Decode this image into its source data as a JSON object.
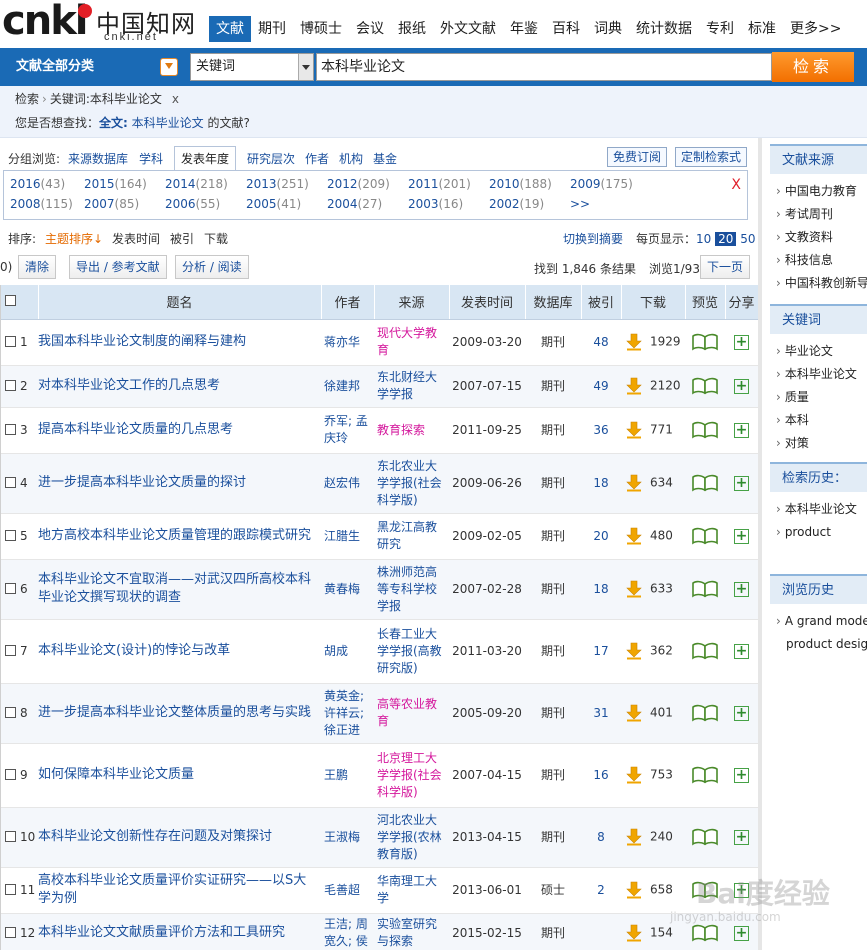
{
  "logo": {
    "zh": "中国知网",
    "sub": "cnki.net",
    "brand": "cnki"
  },
  "nav": [
    "文献",
    "期刊",
    "博硕士",
    "会议",
    "报纸",
    "外文文献",
    "年鉴",
    "百科",
    "词典",
    "统计数据",
    "专利",
    "标准",
    "更多>>"
  ],
  "search": {
    "category": "文献全部分类",
    "field": "关键词",
    "query": "本科毕业论文",
    "button": "检索"
  },
  "breadcrumb": {
    "home": "检索",
    "current": "关键词:本科毕业论文",
    "close": "x"
  },
  "suggest": {
    "prefix": "您是否想查找：",
    "label": "全文:",
    "term": "本科毕业论文",
    "suffix": "的文献?"
  },
  "group": {
    "label": "分组浏览:",
    "items": [
      "来源数据库",
      "学科",
      "发表年度",
      "研究层次",
      "作者",
      "机构",
      "基金"
    ],
    "subscribe": "免费订阅",
    "custom": "定制检索式"
  },
  "years": {
    "row1": [
      {
        "y": "2016",
        "c": "(43)"
      },
      {
        "y": "2015",
        "c": "(164)"
      },
      {
        "y": "2014",
        "c": "(218)"
      },
      {
        "y": "2013",
        "c": "(251)"
      },
      {
        "y": "2012",
        "c": "(209)"
      },
      {
        "y": "2011",
        "c": "(201)"
      },
      {
        "y": "2010",
        "c": "(188)"
      },
      {
        "y": "2009",
        "c": "(175)"
      }
    ],
    "row2": [
      {
        "y": "2008",
        "c": "(115)"
      },
      {
        "y": "2007",
        "c": "(85)"
      },
      {
        "y": "2006",
        "c": "(55)"
      },
      {
        "y": "2005",
        "c": "(41)"
      },
      {
        "y": "2004",
        "c": "(27)"
      },
      {
        "y": "2003",
        "c": "(16)"
      },
      {
        "y": "2002",
        "c": "(19)"
      },
      {
        "y": ">>",
        "c": ""
      }
    ],
    "close": "X"
  },
  "sort": {
    "label": "排序:",
    "items": [
      "主题排序↓",
      "发表时间",
      "被引",
      "下载"
    ],
    "switch": "切换到摘要",
    "per_page_label": "每页显示：",
    "per_page": [
      "10",
      "20",
      "50"
    ]
  },
  "toolbar": {
    "count": "0)",
    "clear": "清除",
    "export": "导出 / 参考文献",
    "analyze": "分析 / 阅读",
    "found": "找到 1,846 条结果",
    "browse": "浏览1/93",
    "next": "下一页"
  },
  "table": {
    "headers": [
      "题名",
      "作者",
      "来源",
      "发表时间",
      "数据库",
      "被引",
      "下载",
      "预览",
      "分享"
    ],
    "rows": [
      {
        "n": "1",
        "title": "我国本科毕业论文制度的阐释与建构",
        "author": "蒋亦华",
        "source": "现代大学教育",
        "mag": true,
        "date": "2009-03-20",
        "db": "期刊",
        "cite": "48",
        "dl": "1929"
      },
      {
        "n": "2",
        "title": "对本科毕业论文工作的几点思考",
        "author": "徐建邦",
        "source": "东北财经大学学报",
        "mag": false,
        "date": "2007-07-15",
        "db": "期刊",
        "cite": "49",
        "dl": "2120"
      },
      {
        "n": "3",
        "title": "提高本科毕业论文质量的几点思考",
        "author": "乔军; 孟庆玲",
        "source": "教育探索",
        "mag": true,
        "date": "2011-09-25",
        "db": "期刊",
        "cite": "36",
        "dl": "771"
      },
      {
        "n": "4",
        "title": "进一步提高本科毕业论文质量的探讨",
        "author": "赵宏伟",
        "source": "东北农业大学学报(社会科学版)",
        "mag": false,
        "date": "2009-06-26",
        "db": "期刊",
        "cite": "18",
        "dl": "634"
      },
      {
        "n": "5",
        "title": "地方高校本科毕业论文质量管理的跟踪模式研究",
        "author": "江腊生",
        "source": "黑龙江高教研究",
        "mag": false,
        "date": "2009-02-05",
        "db": "期刊",
        "cite": "20",
        "dl": "480"
      },
      {
        "n": "6",
        "title": "本科毕业论文不宜取消——对武汉四所高校本科毕业论文撰写现状的调查",
        "author": "黄春梅",
        "source": "株洲师范高等专科学校学报",
        "mag": false,
        "date": "2007-02-28",
        "db": "期刊",
        "cite": "18",
        "dl": "633"
      },
      {
        "n": "7",
        "title": "本科毕业论文(设计)的悖论与改革",
        "author": "胡成",
        "source": "长春工业大学学报(高教研究版)",
        "mag": false,
        "date": "2011-03-20",
        "db": "期刊",
        "cite": "17",
        "dl": "362"
      },
      {
        "n": "8",
        "title": "进一步提高本科毕业论文整体质量的思考与实践",
        "author": "黄英金; 许祥云; 徐正进",
        "source": "高等农业教育",
        "mag": true,
        "date": "2005-09-20",
        "db": "期刊",
        "cite": "31",
        "dl": "401"
      },
      {
        "n": "9",
        "title": "如何保障本科毕业论文质量",
        "author": "王鹏",
        "source": "北京理工大学学报(社会科学版)",
        "mag": true,
        "date": "2007-04-15",
        "db": "期刊",
        "cite": "16",
        "dl": "753"
      },
      {
        "n": "10",
        "title": "本科毕业论文创新性存在问题及对策探讨",
        "author": "王淑梅",
        "source": "河北农业大学学报(农林教育版)",
        "mag": false,
        "date": "2013-04-15",
        "db": "期刊",
        "cite": "8",
        "dl": "240"
      },
      {
        "n": "11",
        "title": "高校本科毕业论文质量评价实证研究——以S大学为例",
        "author": "毛善超",
        "source": "华南理工大学",
        "mag": false,
        "date": "2013-06-01",
        "db": "硕士",
        "cite": "2",
        "dl": "658"
      },
      {
        "n": "12",
        "title": "本科毕业论文文献质量评价方法和工具研究",
        "author": "王洁; 周宽久; 侯",
        "source": "实验室研究与探索",
        "mag": false,
        "date": "2015-02-15",
        "db": "期刊",
        "cite": "",
        "dl": "154"
      }
    ]
  },
  "sidebar": {
    "source_title": "文献来源",
    "sources": [
      "中国电力教育",
      "考试周刊",
      "文教资料",
      "科技信息",
      "中国科教创新导刊"
    ],
    "keyword_title": "关键词",
    "keywords": [
      "毕业论文",
      "本科毕业论文",
      "质量",
      "本科",
      "对策"
    ],
    "history_title": "检索历史：",
    "history": [
      "本科毕业论文",
      "product"
    ],
    "browse_title": "浏览历史",
    "browse": [
      "A grand model",
      "product design"
    ]
  },
  "watermark": {
    "main": "Bai度经验",
    "sub": "jingyan.baidu.com"
  },
  "colors": {
    "brand_blue": "#1a6ab5",
    "search_orange": "#f26f00",
    "link_blue": "#1a4f9c",
    "magenta": "#d4179c"
  }
}
